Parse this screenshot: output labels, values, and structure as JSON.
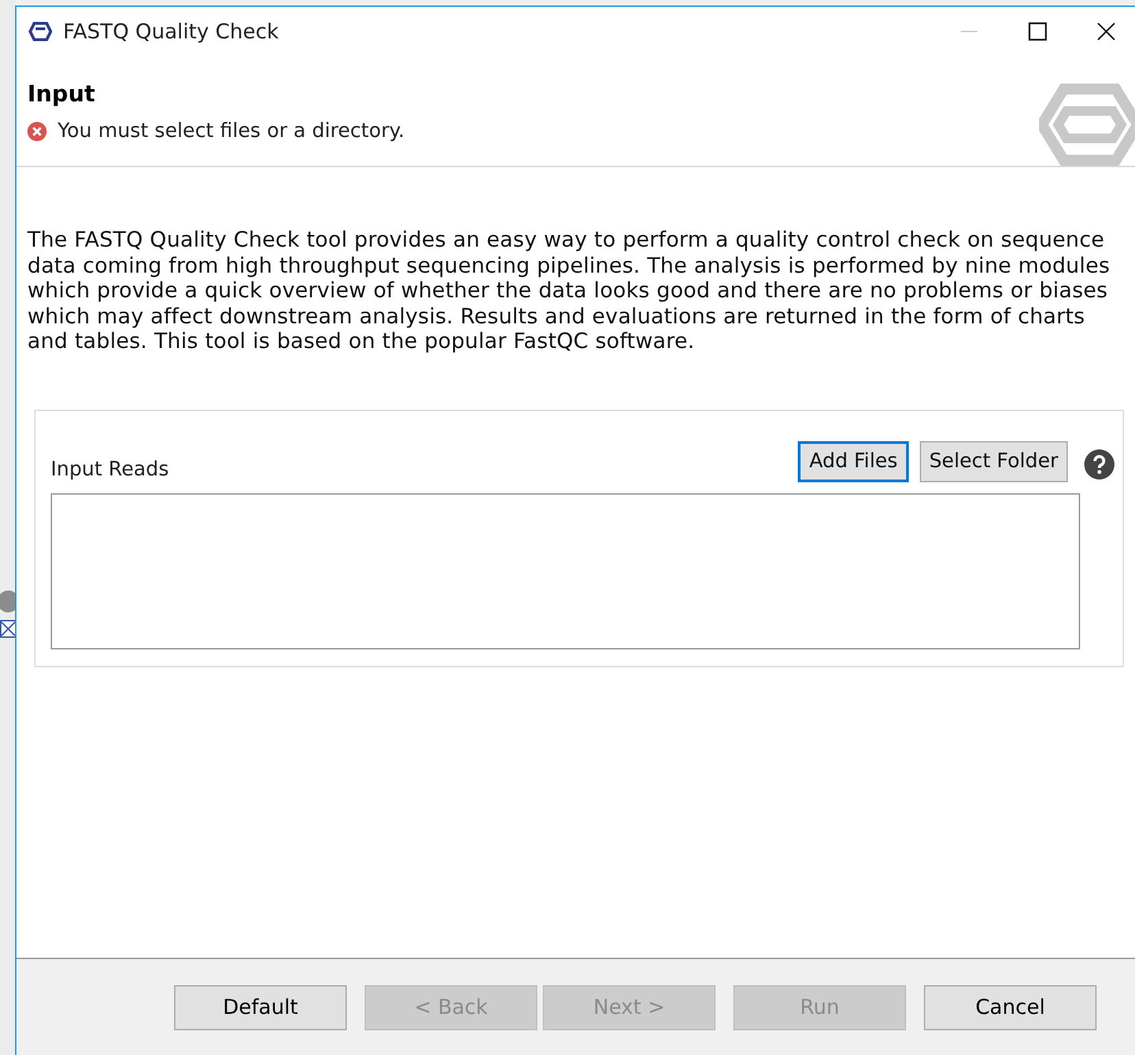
{
  "window": {
    "title": "FASTQ Quality Check"
  },
  "header": {
    "title": "Input",
    "error": "You must select files or a directory."
  },
  "description": "The FASTQ Quality Check tool provides an easy way to perform a quality control check on sequence data coming from high throughput sequencing pipelines. The analysis is performed by nine modules which provide a quick overview of whether the data looks good and there are no problems or biases which may affect downstream analysis. Results and evaluations are returned in the form of charts and tables. This tool is based on the popular FastQC software.",
  "input_reads": {
    "label": "Input Reads",
    "buttons": [
      {
        "label": "Add Files",
        "focused": true
      },
      {
        "label": "Select Folder",
        "focused": false
      }
    ]
  },
  "footer_buttons": [
    {
      "label": "Default",
      "disabled": false
    },
    {
      "label": "< Back",
      "disabled": true
    },
    {
      "label": "Next >",
      "disabled": true
    },
    {
      "label": "Run",
      "disabled": true
    },
    {
      "label": "Cancel",
      "disabled": false
    }
  ]
}
